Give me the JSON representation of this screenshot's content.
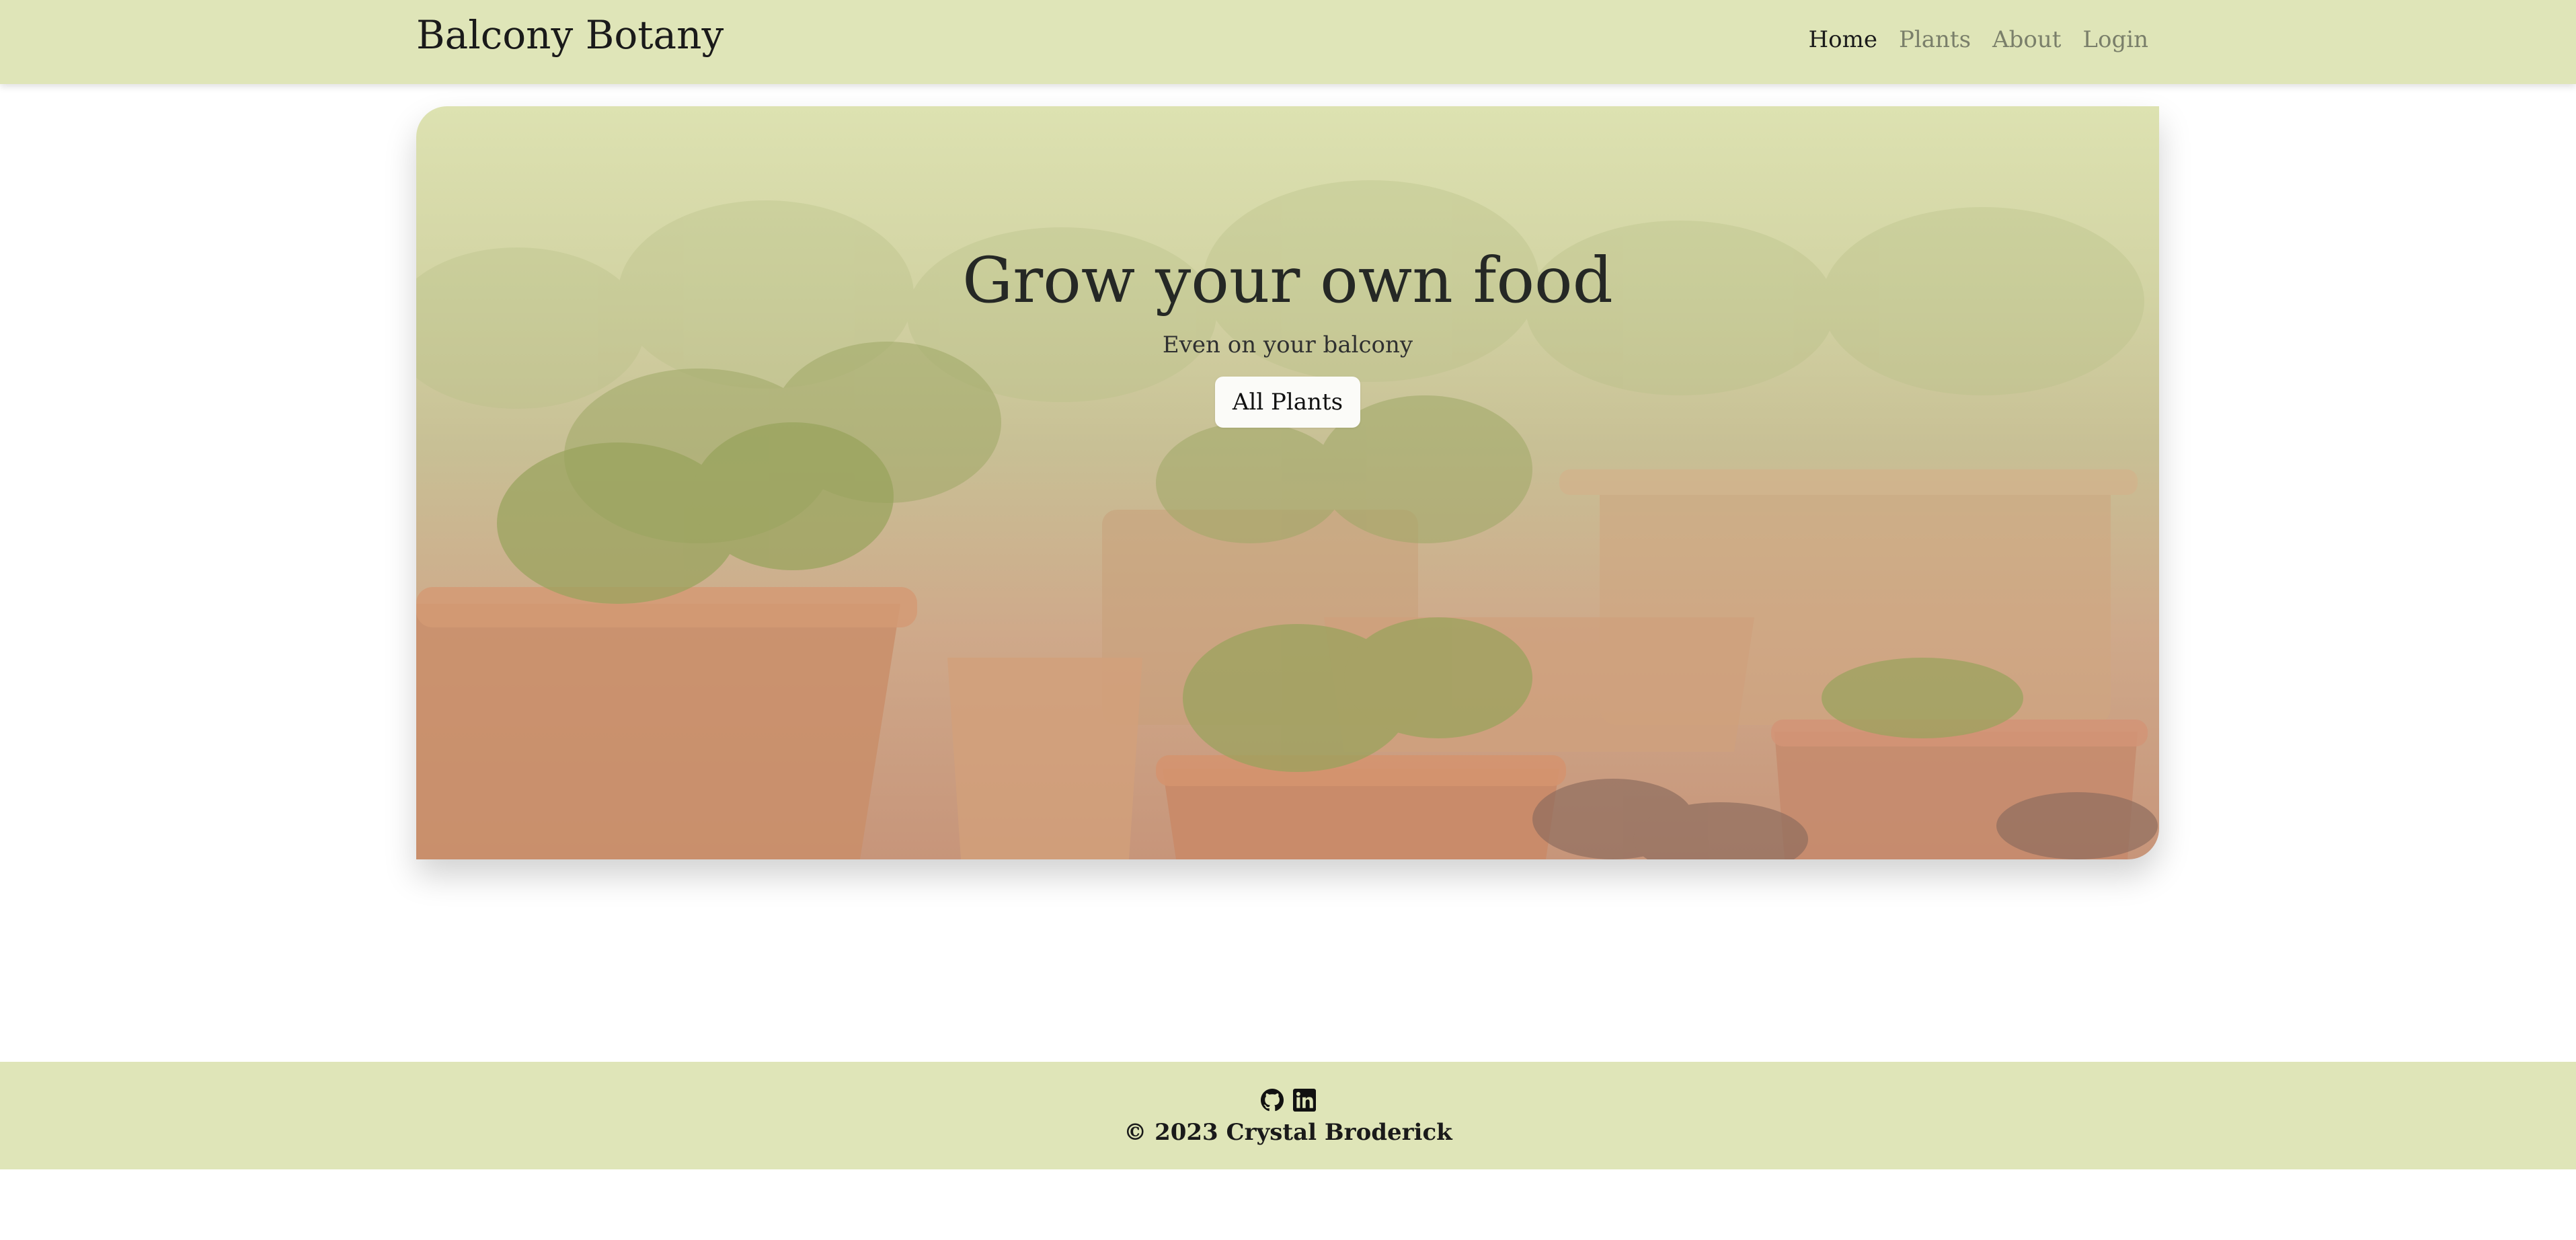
{
  "header": {
    "brand": "Balcony Botany",
    "nav": [
      {
        "label": "Home",
        "active": true
      },
      {
        "label": "Plants",
        "active": false
      },
      {
        "label": "About",
        "active": false
      },
      {
        "label": "Login",
        "active": false
      }
    ]
  },
  "hero": {
    "title": "Grow your own food",
    "subtitle": "Even on your balcony",
    "button_label": "All Plants"
  },
  "footer": {
    "icons": [
      "github-icon",
      "linkedin-icon"
    ],
    "copyright": "© 2023 Crystal Broderick"
  },
  "colors": {
    "header_bg": "#dfe5b8",
    "footer_bg": "#dfe5b8",
    "button_bg": "#fbfbf8",
    "text": "#1c1f1c",
    "inactive_link": "#7a7f6a"
  }
}
